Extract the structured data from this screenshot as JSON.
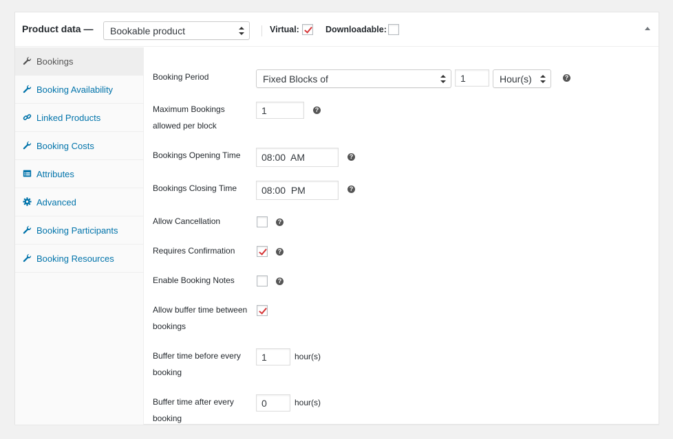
{
  "header": {
    "title": "Product data —",
    "product_type": "Bookable product",
    "virtual_label": "Virtual:",
    "virtual_checked": true,
    "downloadable_label": "Downloadable:",
    "downloadable_checked": false
  },
  "tabs": [
    {
      "label": "Bookings",
      "icon": "wrench-icon",
      "active": true
    },
    {
      "label": "Booking Availability",
      "icon": "wrench-icon",
      "active": false
    },
    {
      "label": "Linked Products",
      "icon": "link-icon",
      "active": false
    },
    {
      "label": "Booking Costs",
      "icon": "wrench-icon",
      "active": false
    },
    {
      "label": "Attributes",
      "icon": "list-icon",
      "active": false
    },
    {
      "label": "Advanced",
      "icon": "gear-icon",
      "active": false
    },
    {
      "label": "Booking Participants",
      "icon": "wrench-icon",
      "active": false
    },
    {
      "label": "Booking Resources",
      "icon": "wrench-icon",
      "active": false
    }
  ],
  "fields": {
    "booking_period": {
      "label": "Booking Period",
      "mode": "Fixed Blocks of",
      "quantity": "1",
      "unit": "Hour(s)"
    },
    "max_bookings": {
      "label_line1": "Maximum Bookings",
      "label_line2": "allowed per block",
      "value": "1"
    },
    "opening_time": {
      "label": "Bookings Opening Time",
      "value": "08:00  AM"
    },
    "closing_time": {
      "label": "Bookings Closing Time",
      "value": "08:00  PM"
    },
    "allow_cancellation": {
      "label": "Allow Cancellation",
      "checked": false
    },
    "requires_confirmation": {
      "label": "Requires Confirmation",
      "checked": true
    },
    "booking_notes": {
      "label": "Enable Booking Notes",
      "checked": false
    },
    "buffer_time": {
      "label_line1": "Allow buffer time between",
      "label_line2": "bookings",
      "checked": true
    },
    "buffer_before": {
      "label_line1": "Buffer time before every",
      "label_line2": "booking",
      "value": "1",
      "unit": "hour(s)"
    },
    "buffer_after": {
      "label_line1": "Buffer time after every",
      "label_line2": "booking",
      "value": "0",
      "unit": "hour(s)"
    }
  },
  "help_glyph": "?",
  "colors": {
    "link": "#0073aa",
    "check": "#d63638"
  }
}
